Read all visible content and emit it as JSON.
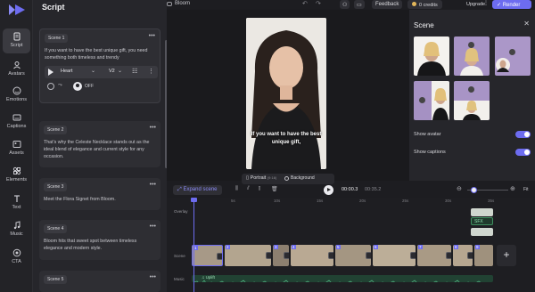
{
  "app": {
    "brand_color": "#6d6cf0",
    "logo_icon": "logo-icon"
  },
  "rail": {
    "items": [
      {
        "label": "Script",
        "icon": "script-icon",
        "active": true
      },
      {
        "label": "Avatars",
        "icon": "avatar-icon"
      },
      {
        "label": "Emotions",
        "icon": "smile-icon"
      },
      {
        "label": "Captions",
        "icon": "captions-icon"
      },
      {
        "label": "Assets",
        "icon": "assets-icon"
      },
      {
        "label": "Elements",
        "icon": "elements-icon"
      },
      {
        "label": "Text",
        "icon": "text-icon"
      },
      {
        "label": "Music",
        "icon": "music-icon"
      },
      {
        "label": "CTA",
        "icon": "cta-icon"
      }
    ]
  },
  "script": {
    "title": "Script",
    "scenes": [
      {
        "label": "Scene 1",
        "text": "If you want to have the best unique gift, you need something both timeless and trendy"
      },
      {
        "label": "Scene 2",
        "text": "That's why the Celeste Necklace stands out as the ideal blend of elegance and current style for any occasion."
      },
      {
        "label": "Scene 3",
        "text": "Meet the Flora Signet from Bloom."
      },
      {
        "label": "Scene 4",
        "text": "Bloom hits that sweet spot between timeless elegance and modern style."
      },
      {
        "label": "Scene 5",
        "text": ""
      }
    ],
    "voice": {
      "name": "Heart",
      "version": "V2",
      "avatar_toggle": "OFF"
    },
    "more_icon": "more-horizontal-icon"
  },
  "topbar": {
    "project_name": "Bloom",
    "feedback_label": "Feedback",
    "credits": "0 credits",
    "upgrade_label": "Upgrade",
    "render_label": "Render"
  },
  "canvas": {
    "subtitle": "If you want to have the best unique gift,",
    "format_label": "Portrait",
    "format_ratio": "(9:16)",
    "background_label": "Background"
  },
  "scene_panel": {
    "title": "Scene",
    "show_avatar_label": "Show avatar",
    "show_avatar": true,
    "show_captions_label": "Show captions",
    "show_captions": true
  },
  "timeline": {
    "expand_label": "Expand scene",
    "current_time": "00:00.3",
    "total_time": "00:35.2",
    "fit_label": "Fit",
    "zoom_level": 0.1,
    "ruler_labels": [
      "5s",
      "10s",
      "15s",
      "20s",
      "25s",
      "30s",
      "35s"
    ],
    "tracks": {
      "overlay": "Overlay",
      "scene": "Scene",
      "music": "Music"
    },
    "overlay_chip": "SFX",
    "music_label": "♫ Uplift",
    "clip_numbers": [
      "1",
      "2",
      "3",
      "4",
      "5",
      "6",
      "7",
      "8",
      "9"
    ]
  }
}
